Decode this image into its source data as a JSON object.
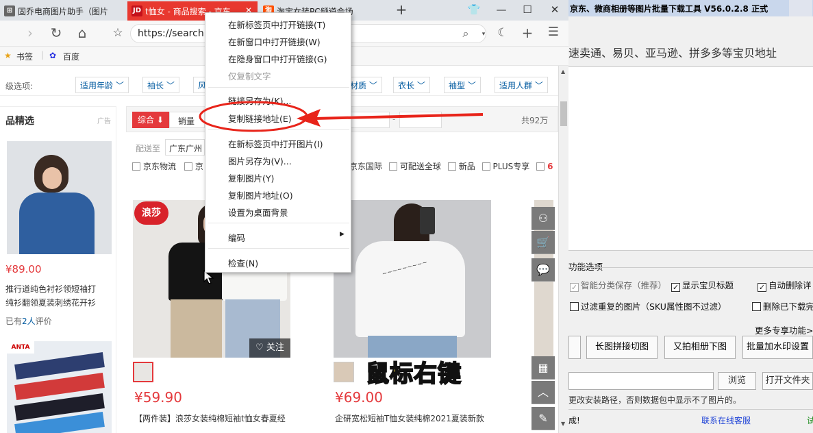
{
  "browser": {
    "tabs": [
      {
        "icon": "⊞",
        "title": "固乔电商图片助手（图片"
      },
      {
        "icon": "JD",
        "title": "t恤女 - 商品搜索 - 京东"
      },
      {
        "icon": "淘",
        "title": "淘宝女装PC频道会场"
      }
    ],
    "new_tab": "+",
    "url": "https://search.",
    "bookmarks": [
      {
        "icon": "★",
        "label": "书签"
      },
      {
        "icon": "✿",
        "label": "百度"
      }
    ]
  },
  "filters": {
    "prefix": "级选项:",
    "options": [
      "适用年龄",
      "袖长",
      "风",
      "材质",
      "衣长",
      "袖型",
      "适用人群"
    ]
  },
  "left": {
    "title": "品精选",
    "ad": "广告",
    "price": "¥89.00",
    "desc1": "推行道纯色衬衫领短袖打",
    "desc2": "纯衫翻领夏装刺绣花开衫",
    "review_prefix": "已有",
    "review_count": "2人",
    "review_suffix": "评价"
  },
  "sort": {
    "active": "综合",
    "sales": "销量",
    "total": "共92万",
    "ship_label": "配送至",
    "ship_value": "广东广州",
    "checks": [
      "京东物流",
      "京",
      "京东国际",
      "可配送全球",
      "新品",
      "PLUS专享",
      "6"
    ]
  },
  "products": [
    {
      "brand": "浪莎",
      "follow": "关注",
      "price": "¥59.90",
      "name": "【两件装】浪莎女装纯棉短袖t恤女春夏经"
    },
    {
      "price": "¥69.00",
      "name": "企研宽松短袖T恤女装纯棉2021夏装新款"
    }
  ],
  "context_menu": [
    {
      "label": "在新标签页中打开链接(T)",
      "disabled": false
    },
    {
      "label": "在新窗口中打开链接(W)",
      "disabled": false
    },
    {
      "label": "在隐身窗口中打开链接(G)",
      "disabled": false
    },
    {
      "label": "仅复制文字",
      "disabled": true
    },
    {
      "label": "链接另存为(K)...",
      "disabled": false
    },
    {
      "label": "复制链接地址(E)",
      "disabled": false
    },
    {
      "label": "在新标签页中打开图片(I)",
      "disabled": false
    },
    {
      "label": "图片另存为(V)...",
      "disabled": false
    },
    {
      "label": "复制图片(Y)",
      "disabled": false
    },
    {
      "label": "复制图片地址(O)",
      "disabled": false
    },
    {
      "label": "设置为桌面背景",
      "disabled": false
    },
    {
      "label": "编码",
      "disabled": false
    },
    {
      "label": "检查(N)",
      "disabled": false
    }
  ],
  "tool": {
    "title": "京东、微商相册等图片批量下载工具 V56.0.2.8 正式",
    "platforms": "速卖通、易贝、亚马逊、拼多多等宝贝地址",
    "func_title": "功能选项",
    "options": [
      {
        "label": "智能分类保存（推荐）",
        "checked": true
      },
      {
        "label": "显示宝贝标题",
        "checked": true
      },
      {
        "label": "自动删除详",
        "checked": true
      },
      {
        "label": "过滤重复的图片（SKU属性图不过滤）",
        "checked": false
      },
      {
        "label": "删除已下载完",
        "checked": false
      }
    ],
    "more": "更多专享功能>>",
    "buttons": [
      "长图拼接切图",
      "又拍相册下图",
      "批量加水印设置"
    ],
    "browse": "浏览",
    "open_folder": "打开文件夹",
    "path_hint": "更改安装路径，否则数据包中显示不了图片的。",
    "status_left": "成!",
    "contact": "联系在线客服",
    "status_right": "试"
  },
  "caption": "鼠标右键",
  "colors": {
    "jd_red": "#e4393c",
    "annotation_red": "#e8241a",
    "caption_yellow": "#ffe84a"
  }
}
